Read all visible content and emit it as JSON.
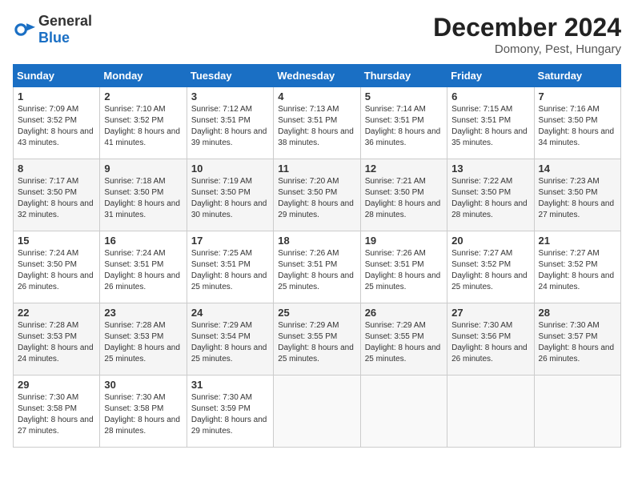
{
  "header": {
    "logo_general": "General",
    "logo_blue": "Blue",
    "month_title": "December 2024",
    "location": "Domony, Pest, Hungary"
  },
  "weekdays": [
    "Sunday",
    "Monday",
    "Tuesday",
    "Wednesday",
    "Thursday",
    "Friday",
    "Saturday"
  ],
  "weeks": [
    [
      {
        "day": "1",
        "sunrise": "7:09 AM",
        "sunset": "3:52 PM",
        "daylight": "8 hours and 43 minutes."
      },
      {
        "day": "2",
        "sunrise": "7:10 AM",
        "sunset": "3:52 PM",
        "daylight": "8 hours and 41 minutes."
      },
      {
        "day": "3",
        "sunrise": "7:12 AM",
        "sunset": "3:51 PM",
        "daylight": "8 hours and 39 minutes."
      },
      {
        "day": "4",
        "sunrise": "7:13 AM",
        "sunset": "3:51 PM",
        "daylight": "8 hours and 38 minutes."
      },
      {
        "day": "5",
        "sunrise": "7:14 AM",
        "sunset": "3:51 PM",
        "daylight": "8 hours and 36 minutes."
      },
      {
        "day": "6",
        "sunrise": "7:15 AM",
        "sunset": "3:51 PM",
        "daylight": "8 hours and 35 minutes."
      },
      {
        "day": "7",
        "sunrise": "7:16 AM",
        "sunset": "3:50 PM",
        "daylight": "8 hours and 34 minutes."
      }
    ],
    [
      {
        "day": "8",
        "sunrise": "7:17 AM",
        "sunset": "3:50 PM",
        "daylight": "8 hours and 32 minutes."
      },
      {
        "day": "9",
        "sunrise": "7:18 AM",
        "sunset": "3:50 PM",
        "daylight": "8 hours and 31 minutes."
      },
      {
        "day": "10",
        "sunrise": "7:19 AM",
        "sunset": "3:50 PM",
        "daylight": "8 hours and 30 minutes."
      },
      {
        "day": "11",
        "sunrise": "7:20 AM",
        "sunset": "3:50 PM",
        "daylight": "8 hours and 29 minutes."
      },
      {
        "day": "12",
        "sunrise": "7:21 AM",
        "sunset": "3:50 PM",
        "daylight": "8 hours and 28 minutes."
      },
      {
        "day": "13",
        "sunrise": "7:22 AM",
        "sunset": "3:50 PM",
        "daylight": "8 hours and 28 minutes."
      },
      {
        "day": "14",
        "sunrise": "7:23 AM",
        "sunset": "3:50 PM",
        "daylight": "8 hours and 27 minutes."
      }
    ],
    [
      {
        "day": "15",
        "sunrise": "7:24 AM",
        "sunset": "3:50 PM",
        "daylight": "8 hours and 26 minutes."
      },
      {
        "day": "16",
        "sunrise": "7:24 AM",
        "sunset": "3:51 PM",
        "daylight": "8 hours and 26 minutes."
      },
      {
        "day": "17",
        "sunrise": "7:25 AM",
        "sunset": "3:51 PM",
        "daylight": "8 hours and 25 minutes."
      },
      {
        "day": "18",
        "sunrise": "7:26 AM",
        "sunset": "3:51 PM",
        "daylight": "8 hours and 25 minutes."
      },
      {
        "day": "19",
        "sunrise": "7:26 AM",
        "sunset": "3:51 PM",
        "daylight": "8 hours and 25 minutes."
      },
      {
        "day": "20",
        "sunrise": "7:27 AM",
        "sunset": "3:52 PM",
        "daylight": "8 hours and 25 minutes."
      },
      {
        "day": "21",
        "sunrise": "7:27 AM",
        "sunset": "3:52 PM",
        "daylight": "8 hours and 24 minutes."
      }
    ],
    [
      {
        "day": "22",
        "sunrise": "7:28 AM",
        "sunset": "3:53 PM",
        "daylight": "8 hours and 24 minutes."
      },
      {
        "day": "23",
        "sunrise": "7:28 AM",
        "sunset": "3:53 PM",
        "daylight": "8 hours and 25 minutes."
      },
      {
        "day": "24",
        "sunrise": "7:29 AM",
        "sunset": "3:54 PM",
        "daylight": "8 hours and 25 minutes."
      },
      {
        "day": "25",
        "sunrise": "7:29 AM",
        "sunset": "3:55 PM",
        "daylight": "8 hours and 25 minutes."
      },
      {
        "day": "26",
        "sunrise": "7:29 AM",
        "sunset": "3:55 PM",
        "daylight": "8 hours and 25 minutes."
      },
      {
        "day": "27",
        "sunrise": "7:30 AM",
        "sunset": "3:56 PM",
        "daylight": "8 hours and 26 minutes."
      },
      {
        "day": "28",
        "sunrise": "7:30 AM",
        "sunset": "3:57 PM",
        "daylight": "8 hours and 26 minutes."
      }
    ],
    [
      {
        "day": "29",
        "sunrise": "7:30 AM",
        "sunset": "3:58 PM",
        "daylight": "8 hours and 27 minutes."
      },
      {
        "day": "30",
        "sunrise": "7:30 AM",
        "sunset": "3:58 PM",
        "daylight": "8 hours and 28 minutes."
      },
      {
        "day": "31",
        "sunrise": "7:30 AM",
        "sunset": "3:59 PM",
        "daylight": "8 hours and 29 minutes."
      },
      null,
      null,
      null,
      null
    ]
  ]
}
